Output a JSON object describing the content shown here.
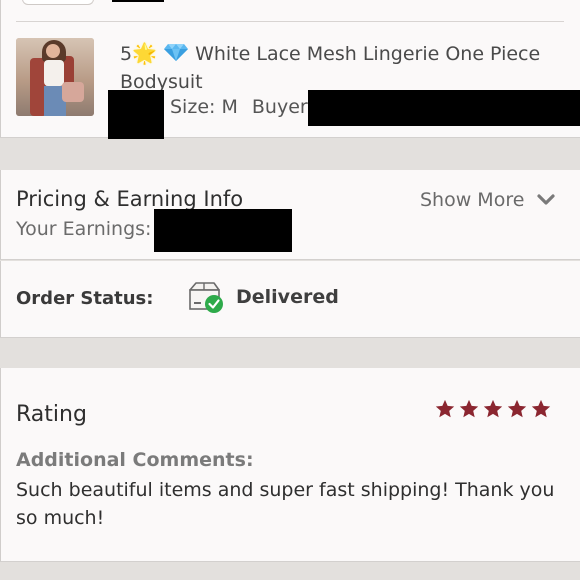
{
  "item": {
    "rating_prefix": "5",
    "star_emoji": "🌟",
    "title": "White Lace Mesh Lingerie One Piece Bodysuit",
    "size_text": "Size: M",
    "buyer_label": "Buyer:"
  },
  "pricing": {
    "title": "Pricing & Earning Info",
    "earnings_label": "Your Earnings:",
    "show_more": "Show More"
  },
  "order": {
    "status_label": "Order Status:",
    "status_value": "Delivered"
  },
  "rating": {
    "title": "Rating",
    "stars": 5,
    "star_color": "#8b2630",
    "comments_label": "Additional Comments:",
    "comment": "Such beautiful items and super fast shipping! Thank you so much!"
  },
  "colors": {
    "delivered_check": "#2eaa4a",
    "background": "#e3e0dd",
    "card": "#fbf9f9"
  }
}
